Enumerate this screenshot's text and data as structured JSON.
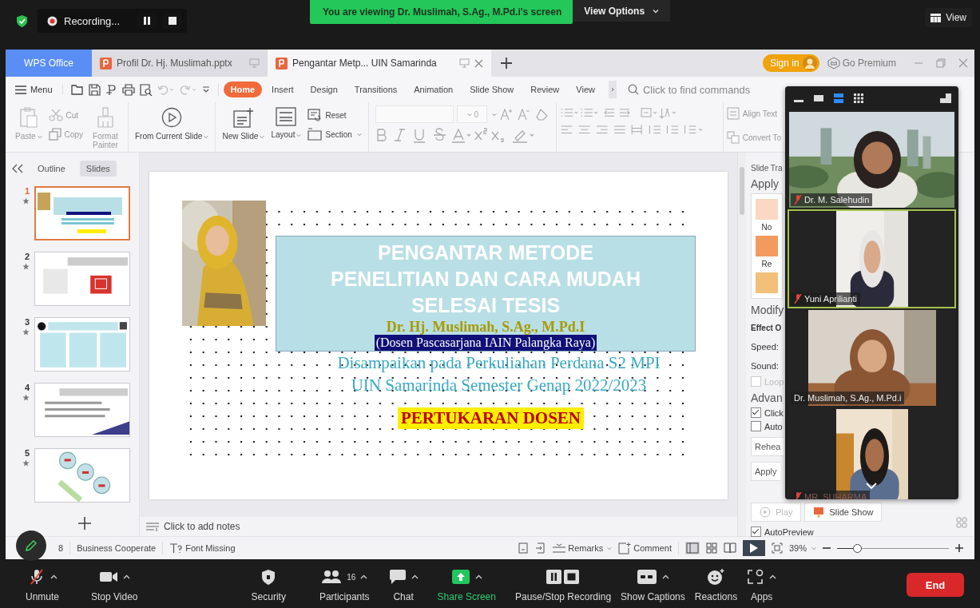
{
  "meeting_bar": {
    "recording_label": "Recording...",
    "banner": "You are viewing Dr. Muslimah, S.Ag., M.Pd.i's screen",
    "view_options": "View Options",
    "view_button": "View"
  },
  "app_tabs": [
    {
      "label": "WPS Office",
      "kind": "home",
      "selected": false
    },
    {
      "label": "Profil Dr. Hj. Muslimah.pptx",
      "kind": "doc",
      "selected": false
    },
    {
      "label": "Pengantar Metp... UIN Samarinda",
      "kind": "doc",
      "selected": true
    }
  ],
  "account": {
    "sign_in": "Sign in",
    "premium": "Go Premium"
  },
  "menu": {
    "label": "Menu",
    "search_placeholder": "Click to find commands",
    "tabs": [
      {
        "label": "Home",
        "selected": true
      },
      {
        "label": "Insert",
        "selected": false
      },
      {
        "label": "Design",
        "selected": false
      },
      {
        "label": "Transitions",
        "selected": false
      },
      {
        "label": "Animation",
        "selected": false
      },
      {
        "label": "Slide Show",
        "selected": false
      },
      {
        "label": "Review",
        "selected": false
      },
      {
        "label": "View",
        "selected": false
      }
    ]
  },
  "ribbon": {
    "paste": "Paste",
    "cut": "Cut",
    "copy": "Copy",
    "format_painter": "Format Painter",
    "from_current_slide": "From Current Slide",
    "new_slide": "New Slide",
    "layout": "Layout",
    "reset": "Reset",
    "section": "Section",
    "font_size": "0",
    "align_text": "Align Text",
    "convert_to": "Convert To"
  },
  "panel_tabs": [
    {
      "label": "Outline",
      "selected": false
    },
    {
      "label": "Slides",
      "selected": true
    }
  ],
  "thumbnails": [
    {
      "number": "1",
      "selected": true
    },
    {
      "number": "2",
      "selected": false
    },
    {
      "number": "3",
      "selected": false
    },
    {
      "number": "4",
      "selected": false
    },
    {
      "number": "5",
      "selected": false
    }
  ],
  "slide": {
    "title_lines": [
      "PENGANTAR METODE",
      "PENELITIAN DAN CARA MUDAH",
      "SELESAI TESIS"
    ],
    "author": "Dr. Hj. Muslimah, S.Ag., M.Pd.I",
    "affiliation": "(Dosen Pascasarjana IAIN Palangka Raya)",
    "subtitle_lines": [
      "Disampaikan pada Perkuliahan Perdana S2 MPI",
      "UIN Samarinda Semester Genap 2022/2023"
    ],
    "tag": "PERTUKARAN DOSEN"
  },
  "notes_placeholder": "Click to add notes",
  "transition_pane": {
    "heading": "Slide Tra",
    "apply_label": "Apply",
    "effects": [
      "No",
      "Re"
    ],
    "modify": "Modify",
    "effect_options": "Effect O",
    "speed": "Speed:",
    "sound": "Sound:",
    "advanced": "Advan",
    "checks": [
      {
        "label": "Loop",
        "checked": false,
        "disabled": true
      },
      {
        "label": "Click",
        "checked": true,
        "disabled": false
      },
      {
        "label": "Auto",
        "checked": false,
        "disabled": false
      }
    ],
    "rehearse": "Rehea",
    "apply_button": "Apply",
    "play": "Play",
    "slide_show": "Slide Show",
    "autopreview": {
      "label": "AutoPreview",
      "checked": true
    }
  },
  "status_bar": {
    "slide_count": "8",
    "template": "Business Cooperate",
    "font_missing": "Font Missing",
    "remarks": "Remarks",
    "comment": "Comment",
    "zoom": "39%",
    "zoom_slider": {
      "level": 0.22
    }
  },
  "video_panel": {
    "views": [
      {
        "kind": "minimize",
        "selected": false
      },
      {
        "kind": "thumbnail",
        "selected": false
      },
      {
        "kind": "speaker",
        "selected": true
      },
      {
        "kind": "gallery",
        "selected": false
      }
    ],
    "tiles": [
      {
        "name": "Dr. M. Salehudin",
        "muted": true,
        "speaking": false,
        "kind": "outdoor"
      },
      {
        "name": "Yuni Aprilianti",
        "muted": true,
        "speaking": true,
        "kind": "wall"
      },
      {
        "name": "Dr. Muslimah, S.Ag., M.Pd.i",
        "muted": false,
        "speaking": false,
        "kind": "room"
      },
      {
        "name": "MR. SUHARMA",
        "muted": true,
        "speaking": false,
        "kind": "bedroom"
      }
    ]
  },
  "toolbar": {
    "items": [
      {
        "kind": "mic",
        "label": "Unmute",
        "muted": true,
        "caret": true
      },
      {
        "kind": "video",
        "label": "Stop Video",
        "caret": true
      },
      {
        "kind": "security",
        "label": "Security",
        "caret": false
      },
      {
        "kind": "participants",
        "label": "Participants",
        "count": "16",
        "caret": true
      },
      {
        "kind": "chat",
        "label": "Chat",
        "caret": true
      },
      {
        "kind": "share",
        "label": "Share Screen",
        "caret": true
      },
      {
        "kind": "record",
        "label": "Pause/Stop Recording",
        "caret": false
      },
      {
        "kind": "captions",
        "label": "Show Captions",
        "caret": true
      },
      {
        "kind": "reactions",
        "label": "Reactions",
        "caret": false
      },
      {
        "kind": "apps",
        "label": "Apps",
        "caret": true
      }
    ],
    "end": "End"
  }
}
